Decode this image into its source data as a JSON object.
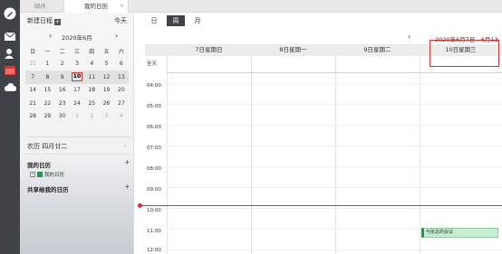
{
  "tabs": [
    {
      "label": "邮件"
    },
    {
      "label": "我的日历",
      "close": "×"
    }
  ],
  "rail_icons": [
    "pencil-icon",
    "mail-icon",
    "contacts-icon",
    "calendar-icon",
    "cloud-icon"
  ],
  "sidebar": {
    "new_schedule": "新建日程",
    "today": "今天",
    "month_title": "2020年6月",
    "prev": "‹",
    "next": "›",
    "weekdays": [
      "日",
      "一",
      "二",
      "三",
      "四",
      "五",
      "六"
    ],
    "weeks": [
      [
        "31",
        "1",
        "2",
        "3",
        "4",
        "5",
        "6"
      ],
      [
        "7",
        "8",
        "9",
        "10",
        "11",
        "12",
        "13"
      ],
      [
        "14",
        "15",
        "16",
        "17",
        "18",
        "19",
        "20"
      ],
      [
        "21",
        "22",
        "23",
        "24",
        "25",
        "26",
        "27"
      ],
      [
        "28",
        "29",
        "30",
        "1",
        "2",
        "3",
        "4"
      ]
    ],
    "lunar": "农历  四月廿二",
    "my_calendars": "我的日历",
    "my_calendar_item": "我的日历",
    "shared_calendars": "共享给我的日历",
    "plus": "+"
  },
  "main": {
    "views": [
      "日",
      "周",
      "月"
    ],
    "active_view": "周",
    "range_prev": "‹",
    "range": "2020年6月7日 - 6月13日",
    "days": [
      "7日星期日",
      "8日星期一",
      "9日星期二",
      "10日星期三"
    ],
    "allday": "全天",
    "times": [
      "04:00",
      "05:00",
      "06:00",
      "07:00",
      "08:00",
      "09:00",
      "10:00",
      "11:00",
      "12:00"
    ],
    "event": "与张总的会议"
  },
  "colors": {
    "accent_red": "#e03030",
    "event_green": "#1a9a4a",
    "rail_dark": "#3f4348"
  }
}
